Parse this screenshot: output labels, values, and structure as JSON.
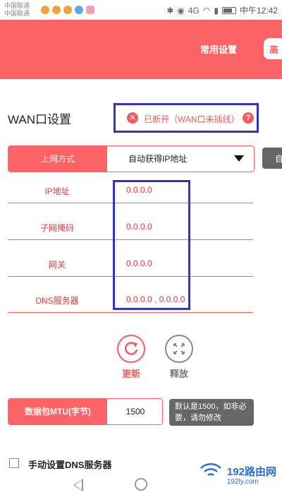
{
  "status_bar": {
    "carrier_1": "中国联通",
    "carrier_2": "中国联通",
    "time": "中午12:42",
    "network": "4G"
  },
  "header": {
    "tab_common": "常用设置",
    "tab_advanced": "高"
  },
  "wan": {
    "title": "WAN口设置",
    "status_text": "已断开（WAN口未插线）"
  },
  "connection": {
    "label": "上网方式",
    "value": "自动获得IP地址",
    "side_button": "自"
  },
  "info": [
    {
      "label": "IP地址",
      "value": "0.0.0.0"
    },
    {
      "label": "子网掩码",
      "value": "0.0.0.0"
    },
    {
      "label": "网关",
      "value": "0.0.0.0"
    },
    {
      "label": "DNS服务器",
      "value": "0.0.0.0 , 0.0.0.0"
    }
  ],
  "actions": {
    "refresh": "更新",
    "release": "释放"
  },
  "mtu": {
    "label": "数据包MTU(字节)",
    "value": "1500",
    "hint": "默认是1500，如非必要，请勿修改"
  },
  "dns": {
    "checkbox_label": "手动设置DNS服务器",
    "checked": false
  },
  "watermark": {
    "brand": "192路由网",
    "url": "192ly.com"
  },
  "colors": {
    "accent": "#fd6266",
    "highlight_box": "#3333bb",
    "hint_bg": "#666666"
  }
}
